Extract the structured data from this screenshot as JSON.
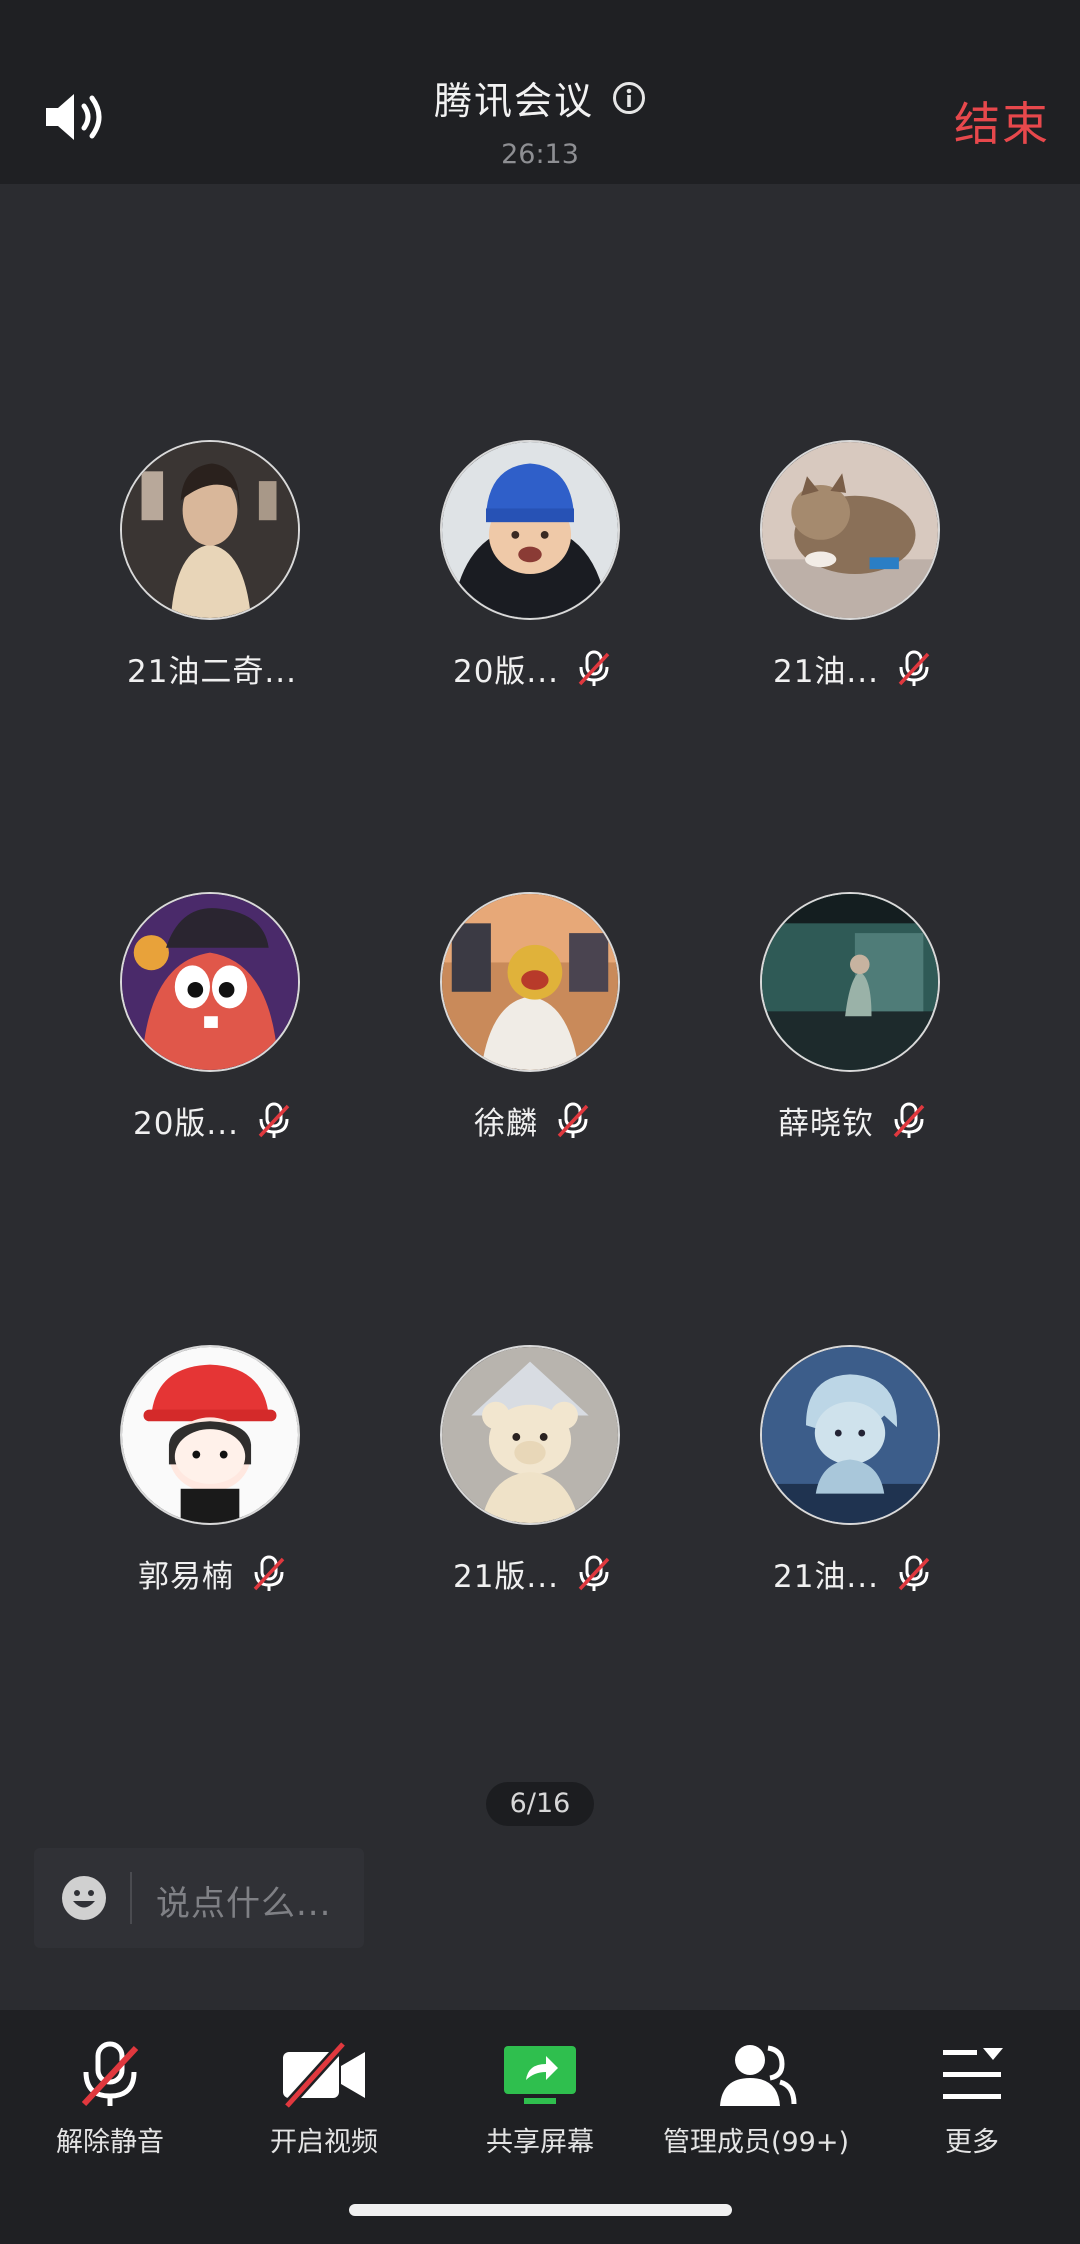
{
  "header": {
    "title": "腾讯会议",
    "timer": "26:13",
    "end_label": "结束",
    "icons": {
      "speaker": "speaker-icon",
      "info": "info-icon"
    }
  },
  "participants": [
    {
      "name": "21油二奇...",
      "muted": false,
      "avatar": "woman-portrait"
    },
    {
      "name": "20版...",
      "muted": true,
      "avatar": "baby-blue-hat"
    },
    {
      "name": "21油...",
      "muted": true,
      "avatar": "cat"
    },
    {
      "name": "20版...",
      "muted": true,
      "avatar": "cartoon-red-creature"
    },
    {
      "name": "徐麟",
      "muted": true,
      "avatar": "man-painting"
    },
    {
      "name": "薛晓钦",
      "muted": true,
      "avatar": "teal-scene"
    },
    {
      "name": "郭易楠",
      "muted": true,
      "avatar": "cartoon-girl-red-hat"
    },
    {
      "name": "21版...",
      "muted": true,
      "avatar": "teddy-bear"
    },
    {
      "name": "21油...",
      "muted": true,
      "avatar": "anime-blue"
    }
  ],
  "pager": "6/16",
  "chat": {
    "placeholder": "说点什么...",
    "icon": "smile-icon"
  },
  "toolbar": [
    {
      "label": "解除静音",
      "icon": "mic-off-icon"
    },
    {
      "label": "开启视频",
      "icon": "video-off-icon"
    },
    {
      "label": "共享屏幕",
      "icon": "share-screen-icon"
    },
    {
      "label": "管理成员(99+)",
      "icon": "members-icon"
    },
    {
      "label": "更多",
      "icon": "more-icon"
    }
  ],
  "colors": {
    "accent_end": "#e7484c",
    "share_green": "#2fbf4e",
    "bg": "#2b2c30",
    "bar": "#1f2023"
  }
}
